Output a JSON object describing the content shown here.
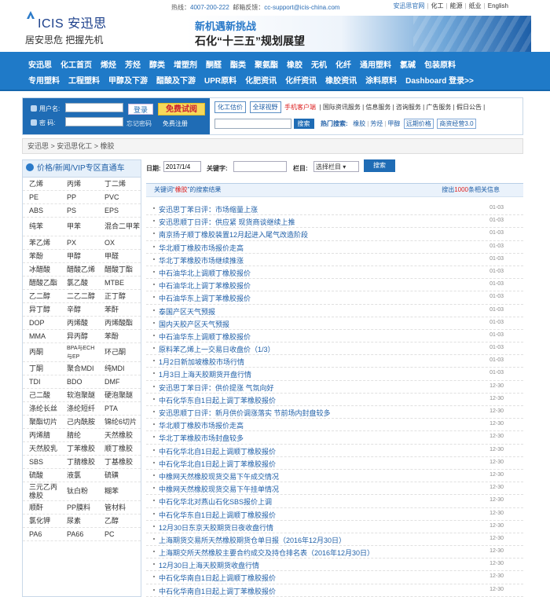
{
  "header": {
    "brand": "ICIS 安迅思",
    "slogan": "居安思危  把握先机",
    "hotline_label": "热线：",
    "hotline": "4007-200-222",
    "email_label": "邮箱反馈：",
    "email": "cc-support@icis-china.com",
    "top_links": [
      "安迅思官网",
      "化工",
      "能源",
      "纸业",
      "English"
    ],
    "banner_line1": "新机遇新挑战",
    "banner_line2": "石化“十三五”规划展望"
  },
  "nav": {
    "row1": [
      "安迅思",
      "化工首页",
      "烯烃",
      "芳烃",
      "醇类",
      "增塑剂",
      "酮醛",
      "酯类",
      "聚氨酯",
      "橡胶",
      "无机",
      "化纤",
      "通用塑料",
      "氯碱",
      "包装原料"
    ],
    "row2": [
      "专用塑料",
      "工程塑料",
      "甲醇及下游",
      "醋酸及下游",
      "UPR原料",
      "化肥资讯",
      "化纤资讯",
      "橡胶资讯",
      "涂料原料",
      "Dashboard 登录>>"
    ]
  },
  "login": {
    "username_label": "用户名:",
    "password_label": "密  码:",
    "login_button": "登录",
    "trial_button": "免费试阅",
    "forgot": "忘记密码",
    "free_register": "免费注册"
  },
  "services": {
    "tag1": "化工估价",
    "tag2": "全球视野",
    "red": "手机客户端",
    "links": "| 国际资讯服务 | 信息服务 | 咨询服务 | 广告服务 | 假日公告 |"
  },
  "search2": {
    "button": "搜索",
    "hot_label": "热门搜索:",
    "hot_keywords": [
      "橡胶",
      "芳烃",
      "甲醇"
    ],
    "box1": "远期价格",
    "box2": "商资经营3.0"
  },
  "breadcrumb": "安迅思 > 安迅思化工 > 橡胶",
  "sidebar": {
    "title": "价格/新闻/VIP专区直通车",
    "rows": [
      [
        "乙烯",
        "丙烯",
        "丁二烯"
      ],
      [
        "PE",
        "PP",
        "PVC"
      ],
      [
        "ABS",
        "PS",
        "EPS"
      ],
      [
        "纯苯",
        "甲苯",
        "混合二甲苯"
      ],
      [
        "苯乙烯",
        "PX",
        "OX"
      ],
      [
        "苯酚",
        "甲醇",
        "甲醛"
      ],
      [
        "冰醋酸",
        "醋酸乙烯",
        "醋酸丁酯"
      ],
      [
        "醋酸乙酯",
        "氯乙酸",
        "MTBE"
      ],
      [
        "乙二醇",
        "二乙二醇",
        "正丁醇"
      ],
      [
        "异丁醇",
        "辛醇",
        "苯酐"
      ],
      [
        "DOP",
        "丙烯酸",
        "丙烯酸酯"
      ],
      [
        "MMA",
        "异丙醇",
        "苯酚"
      ],
      [
        "丙酮",
        "BPA与ECH与EP",
        "环己酮"
      ],
      [
        "丁酮",
        "聚合MDI",
        "纯MDI"
      ],
      [
        "TDI",
        "BDO",
        "DMF"
      ],
      [
        "己二酸",
        "软泡聚醚",
        "硬泡聚醚"
      ],
      [
        "涤纶长丝",
        "涤纶短纤",
        "PTA"
      ],
      [
        "聚酯切片",
        "己内酰胺",
        "锦纶6切片"
      ],
      [
        "丙烯腈",
        "腈纶",
        "天然橡胶"
      ],
      [
        "天然胶乳",
        "丁苯橡胶",
        "顺丁橡胶"
      ],
      [
        "SBS",
        "丁腈橡胶",
        "丁基橡胶"
      ],
      [
        "硫酸",
        "液氯",
        "硫磺"
      ],
      [
        "三元乙丙橡胶",
        "钛白粉",
        "糊苯"
      ],
      [
        "顺酐",
        "PP膜料",
        "管材料"
      ],
      [
        "氯化钾",
        "尿素",
        "乙醇"
      ],
      [
        "PA6",
        "PA66",
        "PC"
      ]
    ]
  },
  "filter": {
    "date_label": "日期:",
    "date_value": "2017/1/4",
    "keyword_label": "关键字:",
    "column_label": "栏目:",
    "column_value": "选择栏目",
    "search_button": "搜索"
  },
  "result": {
    "prefix": "关键词“",
    "keyword": "橡胶",
    "suffix": "”的搜索结果",
    "count_prefix": "搜出",
    "count": "1000",
    "count_suffix": "条相关信息"
  },
  "news": [
    {
      "title": "安迅思丁苯日评：市场缩量上涨",
      "date": "01-03"
    },
    {
      "title": "安迅思顺丁日评：供应紧 现货商谈继续上推",
      "date": "01-03"
    },
    {
      "title": "南京扬子顺丁橡胶装置12月起进入尾气改造阶段",
      "date": "01-03"
    },
    {
      "title": "华北顺丁橡胶市场报价走高",
      "date": "01-03"
    },
    {
      "title": "华北丁苯橡胶市场继续推涨",
      "date": "01-03"
    },
    {
      "title": "中石油华北上调顺丁橡胶报价",
      "date": "01-03"
    },
    {
      "title": "中石油华北上调丁苯橡胶报价",
      "date": "01-03"
    },
    {
      "title": "中石油华东上调丁苯橡胶报价",
      "date": "01-03"
    },
    {
      "title": "泰国产区天气预报",
      "date": "01-03"
    },
    {
      "title": "国内天胶产区天气预报",
      "date": "01-03"
    },
    {
      "title": "中石油华东上调顺丁橡胶报价",
      "date": "01-03"
    },
    {
      "title": "原料苯乙烯上一交易日收盘价（1/3）",
      "date": "01-03"
    },
    {
      "title": "1月2日新加坡橡胶市场行情",
      "date": "01-03"
    },
    {
      "title": "1月3日上海天胶期货开盘行情",
      "date": "01-03"
    },
    {
      "title": "安迅思丁苯日评：供价提涨 气氛向好",
      "date": "12-30"
    },
    {
      "title": "中石化华东自1日起上调丁苯橡胶报价",
      "date": "12-30"
    },
    {
      "title": "安迅思顺丁日评：新月供价调涨落实 节前场内封盘较多",
      "date": "12-30"
    },
    {
      "title": "华北顺丁橡胶市场报价走高",
      "date": "12-30"
    },
    {
      "title": "华北丁苯橡胶市场封盘较多",
      "date": "12-30"
    },
    {
      "title": "中石化华北自1日起上调顺丁橡胶报价",
      "date": "12-30"
    },
    {
      "title": "中石化华北自1日起上调丁苯橡胶报价",
      "date": "12-30"
    },
    {
      "title": "中橡网天然橡胶现货交易下午成交情况",
      "date": "12-30"
    },
    {
      "title": "中橡网天然橡胶现货交易下午挂单情况",
      "date": "12-30"
    },
    {
      "title": "中石化华北对燕山石化SBS报价上调",
      "date": "12-30"
    },
    {
      "title": "中石化华东自1日起上调顺丁橡胶报价",
      "date": "12-30"
    },
    {
      "title": "12月30日东京天胶期货日夜收盘行情",
      "date": "12-30"
    },
    {
      "title": "上海期货交易所天然橡胶期货仓单日报（2016年12月30日）",
      "date": "12-30"
    },
    {
      "title": "上海期交所天然橡胶主要合约成交及持仓排名表（2016年12月30日）",
      "date": "12-30"
    },
    {
      "title": "12月30日上海天胶期货收盘行情",
      "date": "12-30"
    },
    {
      "title": "中石化华南自1日起上调顺丁橡胶报价",
      "date": "12-30"
    },
    {
      "title": "中石化华南自1日起上调丁苯橡胶报价",
      "date": "12-30"
    }
  ]
}
